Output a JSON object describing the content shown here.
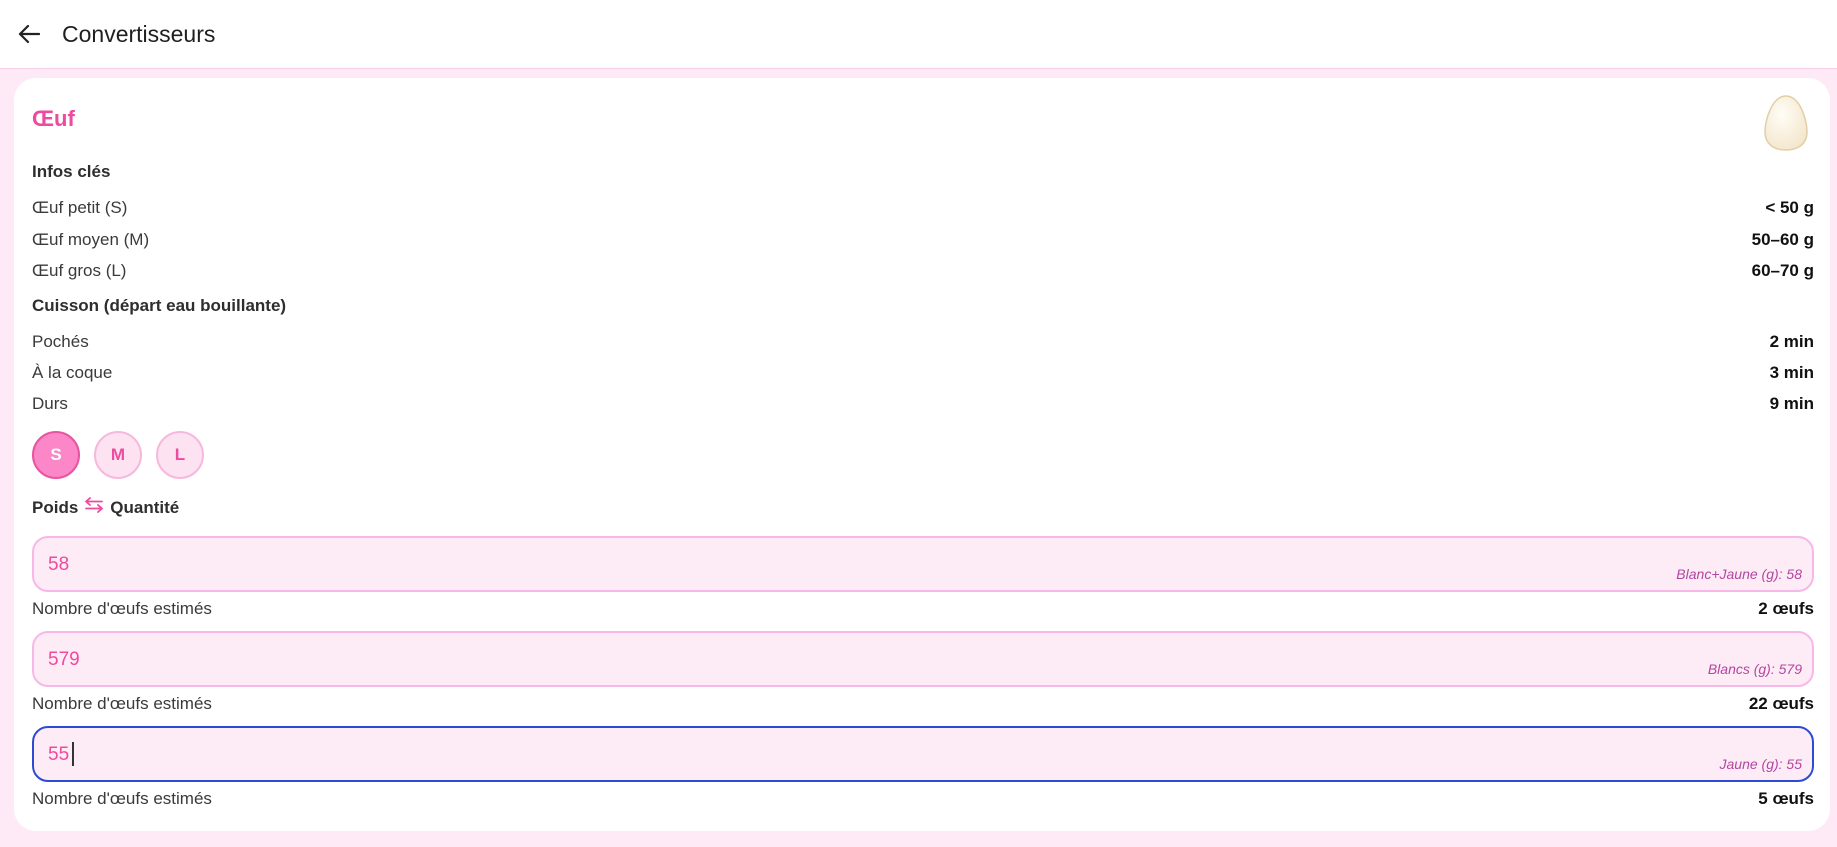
{
  "app": {
    "title": "Convertisseurs"
  },
  "card": {
    "title": "Œuf",
    "key_info_heading": "Infos clés",
    "sizes": [
      {
        "label": "Œuf petit (S)",
        "value": "< 50 g"
      },
      {
        "label": "Œuf moyen (M)",
        "value": "50–60 g"
      },
      {
        "label": "Œuf gros (L)",
        "value": "60–70 g"
      }
    ],
    "cooking_heading": "Cuisson (départ eau bouillante)",
    "cooking": [
      {
        "label": "Pochés",
        "value": "2 min"
      },
      {
        "label": "À la coque",
        "value": "3 min"
      },
      {
        "label": "Durs",
        "value": "9 min"
      }
    ],
    "size_buttons": [
      {
        "label": "S",
        "active": true
      },
      {
        "label": "M",
        "active": false
      },
      {
        "label": "L",
        "active": false
      }
    ],
    "converter": {
      "left": "Poids",
      "icon": "swap-arrows-icon",
      "right": "Quantité"
    },
    "fields": [
      {
        "value": "58",
        "hint": "Blanc+Jaune (g): 58",
        "result_label": "Nombre d'œufs estimés",
        "result_value": "2 œufs"
      },
      {
        "value": "579",
        "hint": "Blancs (g): 579",
        "result_label": "Nombre d'œufs estimés",
        "result_value": "22 œufs"
      },
      {
        "value": "55",
        "hint": "Jaune (g): 55",
        "result_label": "Nombre d'œufs estimés",
        "result_value": "5 œufs"
      }
    ]
  },
  "colors": {
    "accent": "#ee4b9e",
    "background": "#fdeaf6",
    "focus_border": "#2d4bd2"
  }
}
